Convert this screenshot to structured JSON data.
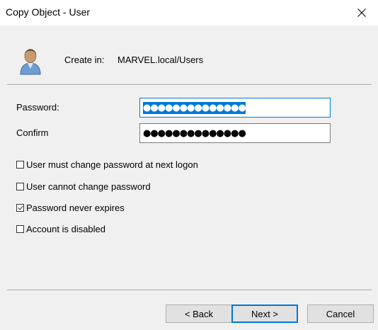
{
  "window": {
    "title": "Copy Object - User"
  },
  "header": {
    "create_in_label": "Create in:",
    "create_in_value": "MARVEL.local/Users"
  },
  "form": {
    "password_label": "Password:",
    "password_value": "●●●●●●●●●●●●●●",
    "confirm_label": "Confirm",
    "confirm_value": "●●●●●●●●●●●●●●"
  },
  "options": [
    {
      "label": "User must change password at next logon",
      "checked": false
    },
    {
      "label": "User cannot change password",
      "checked": false
    },
    {
      "label": "Password never expires",
      "checked": true
    },
    {
      "label": "Account is disabled",
      "checked": false
    }
  ],
  "buttons": {
    "back": "< Back",
    "next": "Next >",
    "cancel": "Cancel"
  },
  "colors": {
    "accent": "#0078d7",
    "background": "#f0f0f0",
    "titlebar": "#ffffff"
  },
  "icons": [
    "close-icon",
    "user-icon"
  ]
}
